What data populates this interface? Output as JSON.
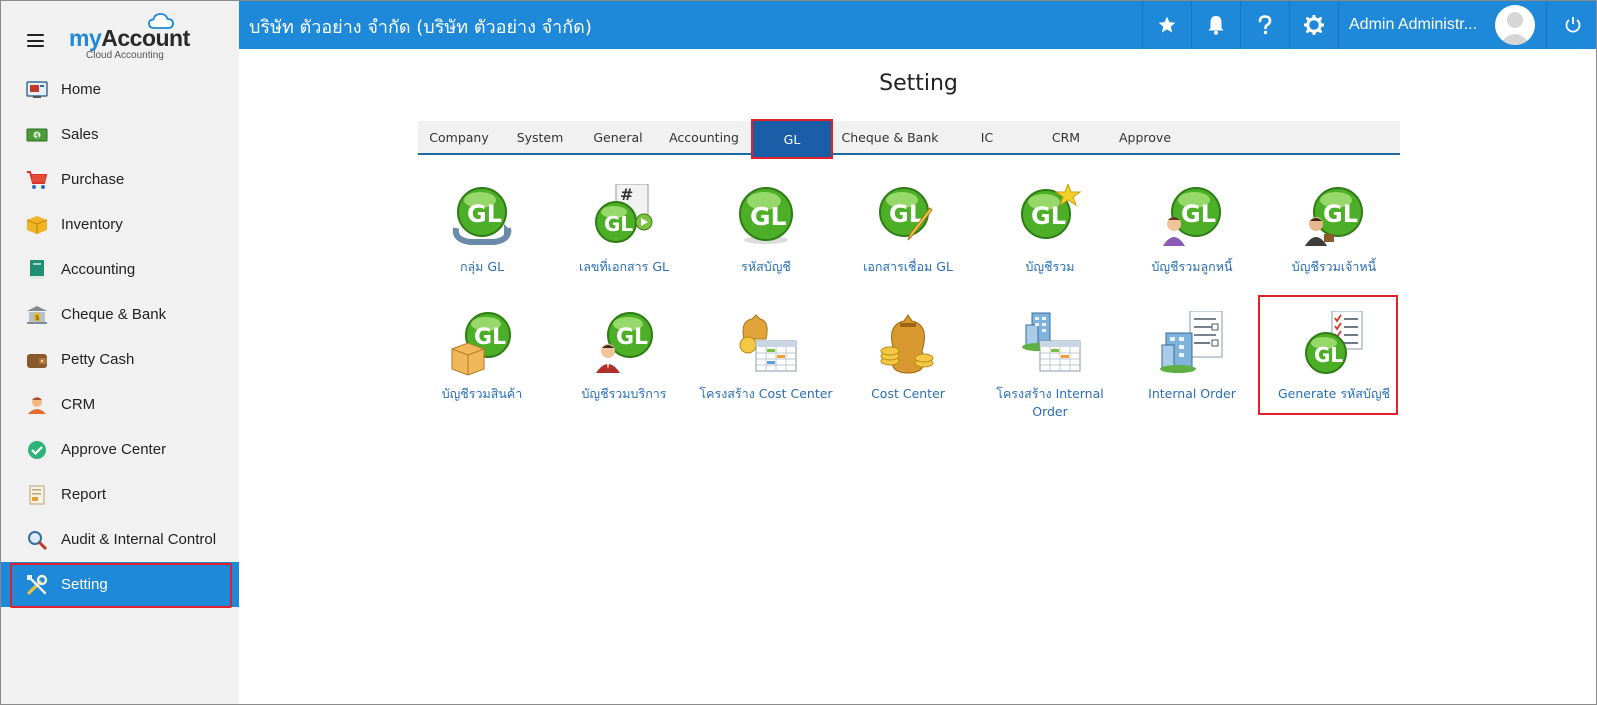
{
  "brand": {
    "name_part1": "my",
    "name_part2": "Account",
    "subtitle": "Cloud Accounting"
  },
  "sidebar": {
    "items": [
      {
        "label": "Home",
        "icon": "home-icon"
      },
      {
        "label": "Sales",
        "icon": "sales-icon"
      },
      {
        "label": "Purchase",
        "icon": "purchase-cart-icon"
      },
      {
        "label": "Inventory",
        "icon": "inventory-box-icon"
      },
      {
        "label": "Accounting",
        "icon": "accounting-book-icon"
      },
      {
        "label": "Cheque & Bank",
        "icon": "bank-icon"
      },
      {
        "label": "Petty Cash",
        "icon": "wallet-icon"
      },
      {
        "label": "CRM",
        "icon": "crm-person-icon"
      },
      {
        "label": "Approve Center",
        "icon": "check-circle-icon"
      },
      {
        "label": "Report",
        "icon": "report-icon"
      },
      {
        "label": "Audit & Internal Control",
        "icon": "audit-magnifier-icon"
      },
      {
        "label": "Setting",
        "icon": "setting-tools-icon",
        "active": true
      }
    ]
  },
  "topbar": {
    "company": "บริษัท ตัวอย่าง จำกัด (บริษัท ตัวอย่าง จำกัด)",
    "user_name": "Admin Administr...",
    "actions": [
      "star-icon",
      "bell-icon",
      "help-icon",
      "gear-icon"
    ]
  },
  "main": {
    "title": "Setting",
    "tabs": [
      {
        "label": "Company"
      },
      {
        "label": "System"
      },
      {
        "label": "General"
      },
      {
        "label": "Accounting"
      },
      {
        "label": "GL",
        "active": true
      },
      {
        "label": "Cheque & Bank"
      },
      {
        "label": "IC"
      },
      {
        "label": "CRM"
      },
      {
        "label": "Approve"
      }
    ],
    "items": [
      {
        "label": "กลุ่ม GL",
        "icon": "gl-group-icon"
      },
      {
        "label": "เลขที่เอกสาร GL",
        "icon": "gl-document-number-icon"
      },
      {
        "label": "รหัสบัญชี",
        "icon": "gl-account-code-icon"
      },
      {
        "label": "เอกสารเชื่อม GL",
        "icon": "gl-link-document-icon"
      },
      {
        "label": "บัญชีรวม",
        "icon": "gl-summary-account-icon"
      },
      {
        "label": "บัญชีรวมลูกหนี้",
        "icon": "gl-debtor-account-icon"
      },
      {
        "label": "บัญชีรวมเจ้าหนี้",
        "icon": "gl-creditor-account-icon"
      },
      {
        "label": "บัญชีรวมสินค้า",
        "icon": "gl-goods-account-icon"
      },
      {
        "label": "บัญชีรวมบริการ",
        "icon": "gl-service-account-icon"
      },
      {
        "label": "โครงสร้าง Cost Center",
        "icon": "cost-center-structure-icon"
      },
      {
        "label": "Cost Center",
        "icon": "cost-center-icon"
      },
      {
        "label": "โครงสร้าง Internal Order",
        "icon": "internal-order-structure-icon"
      },
      {
        "label": "Internal Order",
        "icon": "internal-order-icon"
      },
      {
        "label": "Generate รหัสบัญชี",
        "icon": "generate-account-code-icon",
        "highlighted": true
      }
    ]
  },
  "colors": {
    "primary": "#1e88d9",
    "tab_active": "#1a5ea8",
    "highlight": "#e0202a",
    "link": "#2a6fb5",
    "sidebar_bg": "#f1f1f1"
  }
}
